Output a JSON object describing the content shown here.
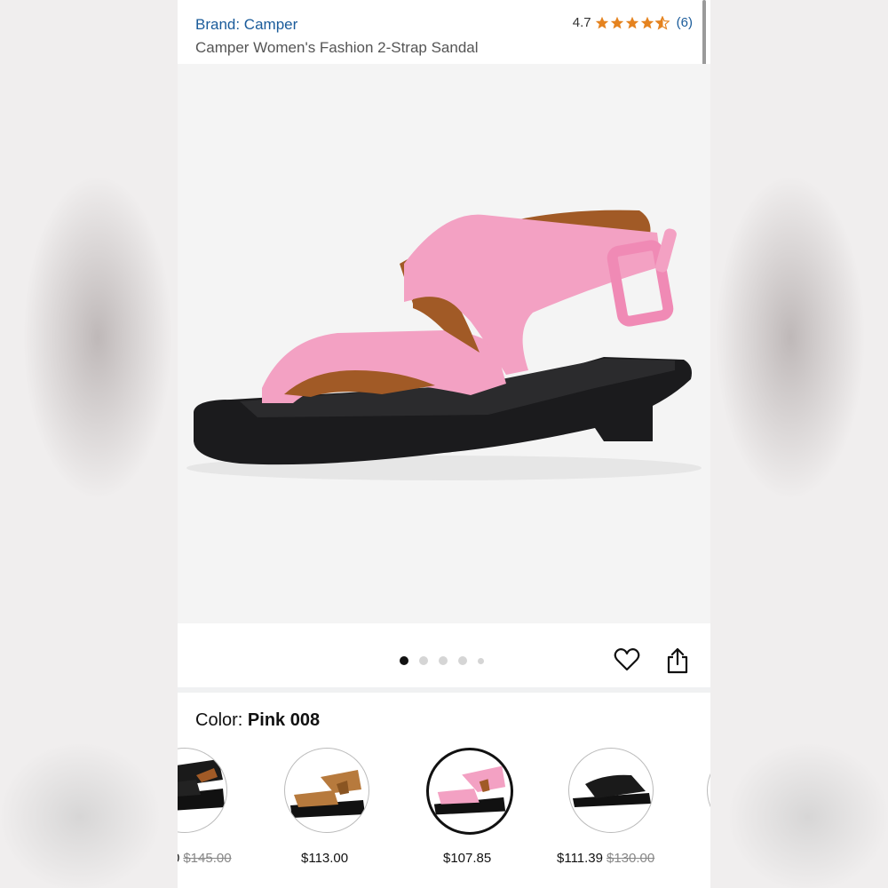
{
  "header": {
    "brand": "Brand: Camper",
    "title": "Camper Women's Fashion 2-Strap Sandal",
    "rating_value": "4.7",
    "rating_count": "(6)",
    "stars": 4.7
  },
  "gallery": {
    "image_icon": "pink-sandal-image",
    "dot_count": 5,
    "active_index": 0
  },
  "actions": {
    "wishlist_icon": "heart-icon",
    "share_icon": "share-icon"
  },
  "color": {
    "label": "Color:",
    "selected": "Pink 008"
  },
  "swatches": [
    {
      "name": "black-sandal-swatch",
      "price": "0",
      "original_price": "$145.00"
    },
    {
      "name": "brown-sandal-swatch",
      "price": "$113.00",
      "original_price": ""
    },
    {
      "name": "pink-sandal-swatch",
      "price": "$107.85",
      "original_price": ""
    },
    {
      "name": "black-slide-swatch",
      "price": "$111.39",
      "original_price": "$130.00"
    }
  ],
  "colors": {
    "link": "#1a5b9a",
    "star": "#e5831f",
    "sandal_pink": "#f3a1c3",
    "sole": "#1b1b1d",
    "lining": "#a15a26"
  }
}
